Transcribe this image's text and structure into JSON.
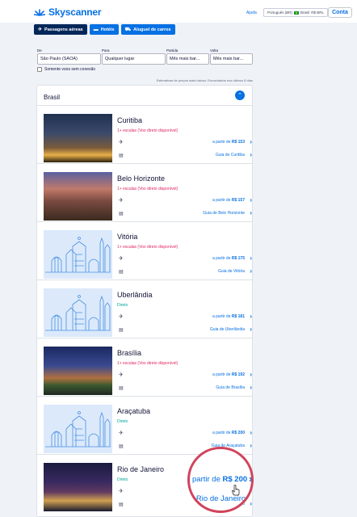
{
  "header": {
    "logo": "Skyscanner",
    "help": "Ajuda",
    "locale": "Português (BR)",
    "country": "Brasil",
    "currency": "R$ BRL",
    "account": "Conta"
  },
  "tabs": [
    {
      "label": "Passagens aéreas",
      "icon": "plane-icon",
      "active": true
    },
    {
      "label": "Hotéis",
      "icon": "bed-icon",
      "active": false
    },
    {
      "label": "Aluguel de carros",
      "icon": "car-icon",
      "active": false
    }
  ],
  "search": {
    "from_label": "De",
    "from_value": "São Paulo (SAOA)",
    "to_label": "Para",
    "to_value": "Qualquer lugar",
    "depart_label": "Partida",
    "depart_value": "Mês mais bar...",
    "return_label": "Volta",
    "return_value": "Mês mais bar...",
    "direct_label": "Somente voos sem conexão"
  },
  "disclaimer": "Estimativas de preços mais baixos. Encontrados nos últimos 8 dias.",
  "panel": {
    "title": "Brasil",
    "cards": [
      {
        "city": "Curitiba",
        "sub": "1+ escalas (Voo direto disponível)",
        "sub_type": "stops",
        "price_prefix": "a partir de ",
        "price": "R$ 153",
        "guide": "Guia de Curitiba",
        "image": "photo-night"
      },
      {
        "city": "Belo Horizonte",
        "sub": "1+ escalas (Voo direto disponível)",
        "sub_type": "stops",
        "price_prefix": "a partir de ",
        "price": "R$ 157",
        "guide": "Guia de Belo Horizonte",
        "image": "photo-sunset"
      },
      {
        "city": "Vitória",
        "sub": "1+ escalas (Voo direto disponível)",
        "sub_type": "stops",
        "price_prefix": "a partir de ",
        "price": "R$ 175",
        "guide": "Guia de Vitória",
        "image": "illustration"
      },
      {
        "city": "Uberlândia",
        "sub": "Direto",
        "sub_type": "direct",
        "price_prefix": "a partir de ",
        "price": "R$ 181",
        "guide": "Guia de Uberlândia",
        "image": "illustration"
      },
      {
        "city": "Brasília",
        "sub": "1+ escalas (Voo direto disponível)",
        "sub_type": "stops",
        "price_prefix": "a partir de ",
        "price": "R$ 192",
        "guide": "Guia de Brasília",
        "image": "photo-dusk"
      },
      {
        "city": "Araçatuba",
        "sub": "Direto",
        "sub_type": "direct",
        "price_prefix": "a partir de ",
        "price": "R$ 200",
        "guide": "Guia de Araçatuba",
        "image": "illustration"
      },
      {
        "city": "Rio de Janeiro",
        "sub": "Direto",
        "sub_type": "direct",
        "price_prefix": "a partir de ",
        "price": "R$ 200",
        "guide": "Guia de Rio de Janeiro",
        "image": "photo-night-city"
      }
    ]
  },
  "magnifier": {
    "price_prefix": "partir de ",
    "price": "R$ 200",
    "guide": "e Rio de Janeiro"
  },
  "colors": {
    "brand": "#0770e3",
    "nav_dark": "#042759",
    "stops": "#e0245e",
    "direct": "#00a698",
    "highlight": "#d1435b"
  }
}
